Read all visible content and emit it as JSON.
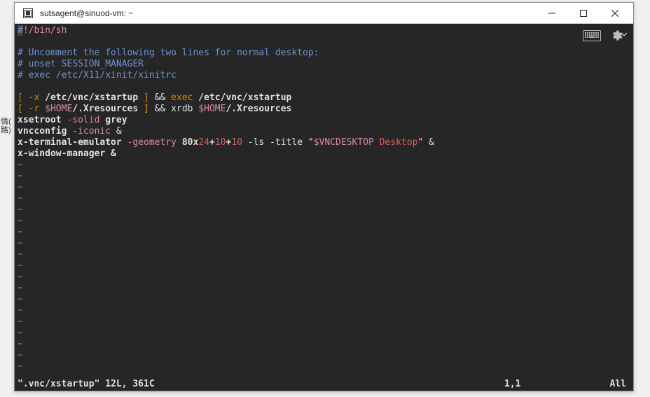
{
  "window": {
    "title": "sutsagent@sinuod-vm: ~"
  },
  "toolbar": {
    "keyboard_icon": "keyboard-icon",
    "gear_icon": "gear-icon"
  },
  "side_chars": {
    "c1": "情(",
    "c2": "路)"
  },
  "editor": {
    "l1": {
      "shebang_hash": "#",
      "shebang": "!/bin/sh"
    },
    "blank": "",
    "l3": "# Uncomment the following two lines for normal desktop:",
    "l4": "# unset SESSION_MANAGER",
    "l5": "# exec /etc/X11/xinit/xinitrc",
    "l7": {
      "a": "[",
      "b": " -x ",
      "c": "/etc/vnc/xstartup",
      "d": " ]",
      "e": " && ",
      "f": "exec",
      "g": " /etc/vnc/xstartup"
    },
    "l8": {
      "a": "[",
      "b": " -r ",
      "c": "$HOME",
      "d": "/.Xresources",
      "e": " ]",
      "f": " && xrdb ",
      "g": "$HOME",
      "h": "/.Xresources"
    },
    "l9": {
      "a": "xsetroot ",
      "b": "-solid",
      "c": " grey"
    },
    "l10": {
      "a": "vncconfig ",
      "b": "-iconic",
      "c": " &"
    },
    "l11": {
      "a": "x-terminal-emulator ",
      "b": "-geometry",
      "c": " 80x",
      "d": "24",
      "e": "+",
      "f": "10",
      "g": "+",
      "h": "10",
      "i": " -ls -title ",
      "j": "\"",
      "k": "$VNCDESKTOP",
      "l": " Desktop",
      "m": "\"",
      "n": " &"
    },
    "l12": {
      "a": "x-window-manager &"
    },
    "tilde": "~"
  },
  "status": {
    "left": "\".vnc/xstartup\" 12L, 361C",
    "pos": "1,1",
    "right": "All"
  }
}
